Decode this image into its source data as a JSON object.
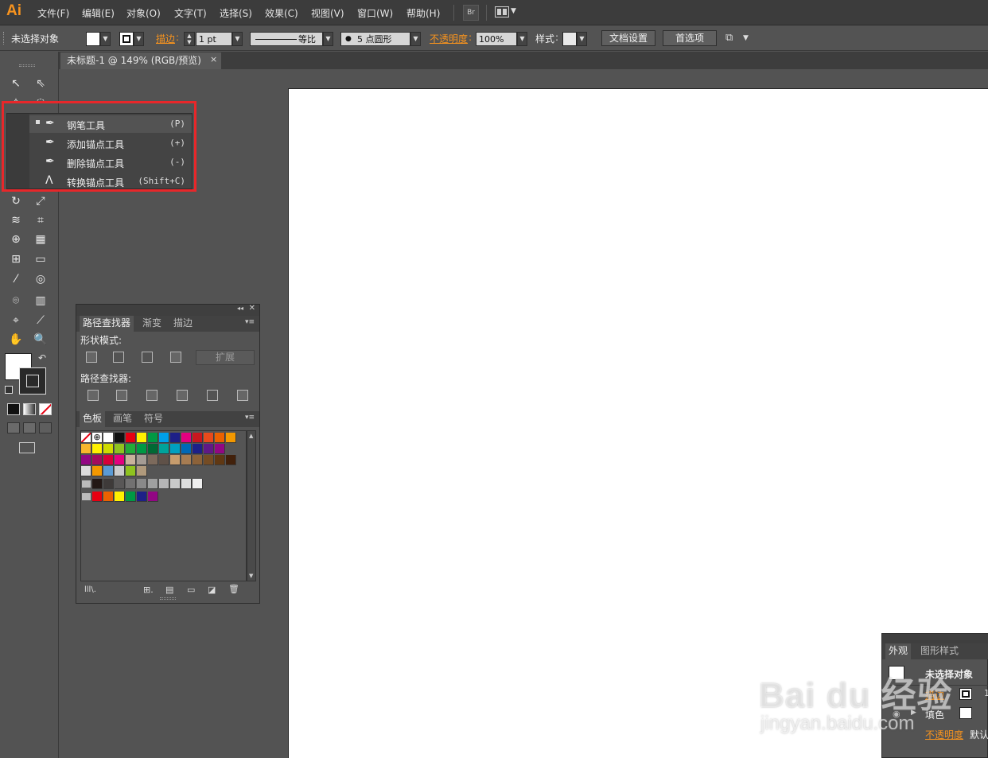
{
  "app": {
    "logo": "Ai"
  },
  "menu": [
    "文件(F)",
    "编辑(E)",
    "对象(O)",
    "文字(T)",
    "选择(S)",
    "效果(C)",
    "视图(V)",
    "窗口(W)",
    "帮助(H)"
  ],
  "bridge_button": "Br",
  "control": {
    "selection_label": "未选择对象",
    "stroke_label": "描边",
    "stroke_weight": "1 pt",
    "profile_label": "等比",
    "brush_label": "5 点圆形",
    "opacity_label": "不透明度",
    "opacity_value": "100%",
    "style_label": "样式",
    "doc_setup_button": "文档设置",
    "prefs_button": "首选项"
  },
  "document_tab": {
    "title": "未标题-1 @ 149% (RGB/预览)",
    "close": "×"
  },
  "flyout": {
    "items": [
      {
        "label": "钢笔工具",
        "shortcut": "(P)",
        "selected": true
      },
      {
        "label": "添加锚点工具",
        "shortcut": "(+)"
      },
      {
        "label": "删除锚点工具",
        "shortcut": "(-)"
      },
      {
        "label": "转换锚点工具",
        "shortcut": "(Shift+C)"
      }
    ]
  },
  "pathfinder_panel": {
    "tabs": [
      "路径查找器",
      "渐变",
      "描边"
    ],
    "shape_modes_label": "形状模式:",
    "expand_button": "扩展",
    "pathfinders_label": "路径查找器:"
  },
  "swatches_panel": {
    "tabs": [
      "色板",
      "画笔",
      "符号"
    ],
    "rows": [
      [
        "#ffffff",
        "#ffffff",
        "#ffffff",
        "#111111",
        "#e60012",
        "#fff100",
        "#009944",
        "#00a0e9",
        "#1d2088",
        "#e4007f",
        "#c9171e",
        "#e84a1b",
        "#eb6100",
        "#f39800"
      ],
      [
        "#f8b62d",
        "#fff100",
        "#cfdb00",
        "#8fc31f",
        "#22ac38",
        "#009944",
        "#006934",
        "#00a39a",
        "#00a0c1",
        "#0068b7",
        "#1d2088",
        "#601986",
        "#920783"
      ],
      [
        "#920783",
        "#a40b5d",
        "#d7003a",
        "#e4007f",
        "#c9b29b",
        "#a59c94",
        "#7c6a5c",
        "#5f5148",
        "#c69c6d",
        "#a67c52",
        "#8c6239",
        "#754c24",
        "#603813",
        "#42210b"
      ],
      [
        "#dddddd",
        "#f39800",
        "#5b9bd5",
        "#cccccc",
        "#8fc31f",
        "#b09a7c"
      ],
      [
        "#231815",
        "#3e3a39",
        "#595757",
        "#727171",
        "#898989",
        "#9fa0a0",
        "#b5b5b6",
        "#c9caca",
        "#dcdddd",
        "#efefef"
      ],
      [
        "#e60012",
        "#eb6100",
        "#fff100",
        "#009944",
        "#1d2088",
        "#920783"
      ]
    ]
  },
  "appearance_panel": {
    "tabs": [
      "外观",
      "图形样式"
    ],
    "title": "未选择对象",
    "stroke_label": "描边",
    "fill_label": "填色",
    "opacity_label": "不透明度",
    "opacity_value": "默认"
  },
  "watermark": {
    "line1": "Bai du 经验",
    "line2": "jingyan.baidu.com"
  }
}
